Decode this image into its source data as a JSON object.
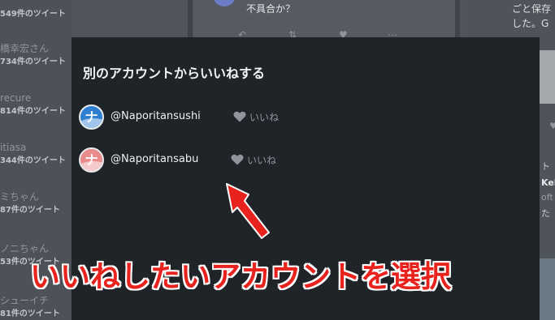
{
  "background": {
    "accounts": [
      {
        "name": "橋幸宏さん",
        "count": "734件のツイート"
      },
      {
        "name": "recure",
        "count": "814件のツイート"
      },
      {
        "name": "itiasa",
        "count": "344件のツイート"
      },
      {
        "name": "ミちゃん",
        "count": "87件のツイート"
      },
      {
        "name": "ノニちゃん",
        "count": "53件のツイート"
      },
      {
        "name": "シューイチ",
        "count": "81件のツイート"
      }
    ],
    "top_count": "549件のツイート",
    "middle_tweet_text": "不具合か？",
    "right_text_1": "ごと保存",
    "right_text_2": "した。G",
    "right_text_3": "Kel",
    "right_text_4": "oft",
    "right_text_5": "た",
    "right_text_6": "ト"
  },
  "modal": {
    "title": "別のアカウントからいいねする",
    "accounts": [
      {
        "handle": "@Naporitansushi",
        "like_label": "いいね",
        "avatar_glyph": "ナ"
      },
      {
        "handle": "@Naporitansabu",
        "like_label": "いいね",
        "avatar_glyph": "ナ"
      }
    ]
  },
  "annotation": {
    "text": "いいねしたいアカウントを選択",
    "color": "#e8231e"
  },
  "colors": {
    "modal_bg": "#1f2429",
    "like_gray": "#8f959b",
    "avatar_blue": "#2f7fd0",
    "avatar_pink": "#e98b8b"
  },
  "icons": [
    "heart-icon",
    "retweet-icon",
    "reply-icon",
    "more-icon"
  ]
}
